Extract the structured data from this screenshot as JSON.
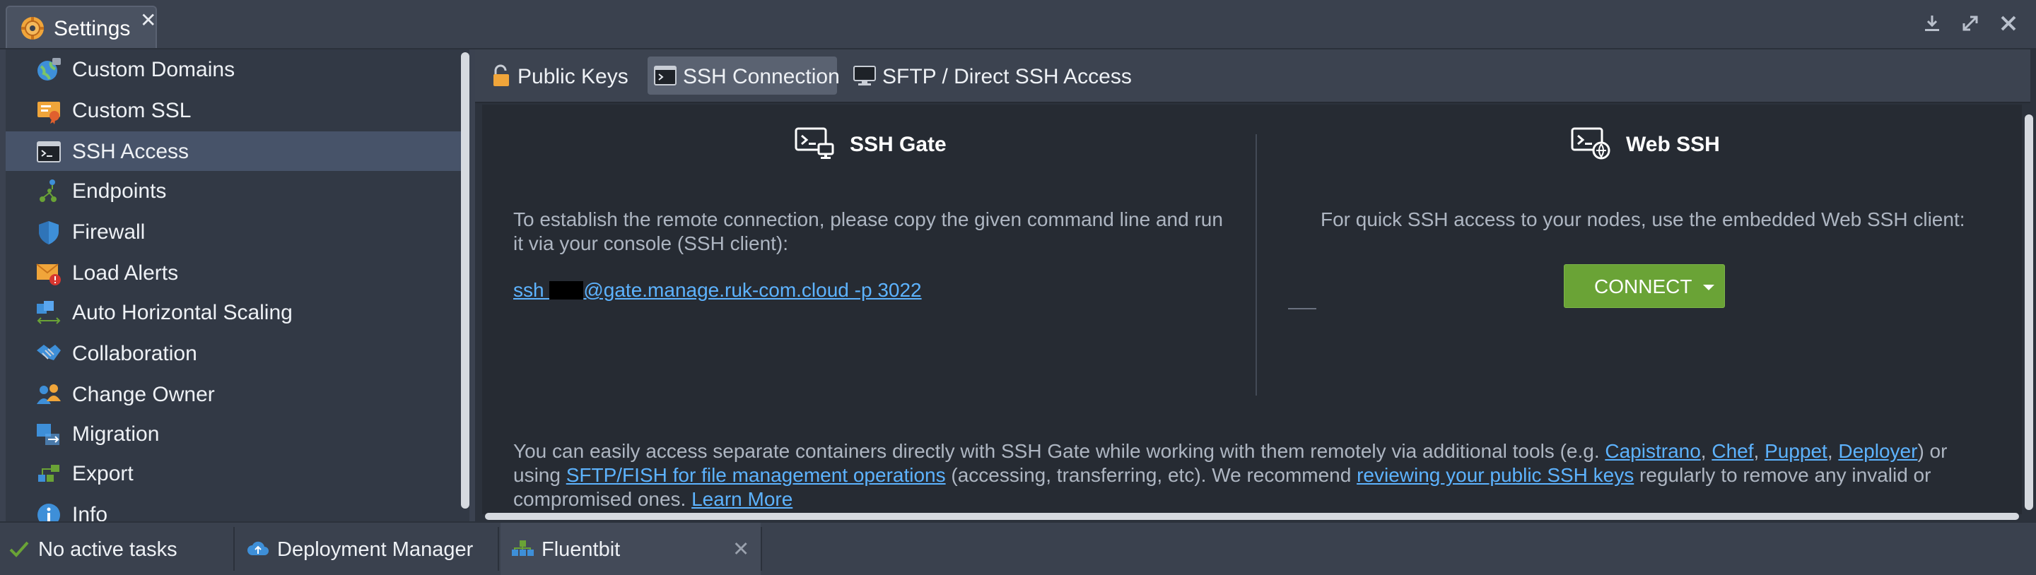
{
  "window": {
    "tab_title": "Settings",
    "close_glyph": "✕",
    "controls": [
      "download-icon",
      "expand-icon",
      "close-icon"
    ]
  },
  "sidebar": {
    "items": [
      {
        "label": "Custom Domains",
        "icon": "globe-icon"
      },
      {
        "label": "Custom SSL",
        "icon": "certificate-icon"
      },
      {
        "label": "SSH Access",
        "icon": "terminal-icon",
        "active": true
      },
      {
        "label": "Endpoints",
        "icon": "endpoints-icon"
      },
      {
        "label": "Firewall",
        "icon": "shield-icon"
      },
      {
        "label": "Load Alerts",
        "icon": "alert-envelope-icon"
      },
      {
        "label": "Auto Horizontal Scaling",
        "icon": "scaling-icon"
      },
      {
        "label": "Collaboration",
        "icon": "handshake-icon"
      },
      {
        "label": "Change Owner",
        "icon": "users-icon"
      },
      {
        "label": "Migration",
        "icon": "migration-icon"
      },
      {
        "label": "Export",
        "icon": "export-icon"
      },
      {
        "label": "Info",
        "icon": "info-icon"
      }
    ]
  },
  "tabs": [
    {
      "label": "Public Keys",
      "icon": "lock-icon"
    },
    {
      "label": "SSH Connection",
      "icon": "terminal-icon",
      "active": true
    },
    {
      "label": "SFTP / Direct SSH Access",
      "icon": "monitor-icon"
    }
  ],
  "ssh_gate": {
    "title": "SSH Gate",
    "description": "To establish the remote connection, please copy the given command line and run it via your console (SSH client):",
    "command_prefix": "ssh ",
    "command_suffix": "@gate.manage.ruk-com.cloud -p 3022"
  },
  "web_ssh": {
    "title": "Web SSH",
    "description": "For quick SSH access to your nodes, use the embedded Web SSH client:",
    "connect_label": "CONNECT",
    "accent": "#6aa336"
  },
  "footer_note": {
    "part1": "You can easily access separate containers directly with SSH Gate while working with them remotely via additional tools (e.g. ",
    "capistrano": "Capistrano",
    "comma1": ", ",
    "chef": "Chef",
    "comma2": ", ",
    "puppet": "Puppet",
    "comma3": ", ",
    "deployer": "Deployer",
    "part2": ") or using ",
    "sftp_fish": "SFTP/FISH for file management operations",
    "part3": " (accessing, transferring, etc). We recommend ",
    "review_keys": "reviewing your public SSH keys",
    "part4": " regularly to remove any invalid or compromised ones. ",
    "learn_more": "Learn More"
  },
  "taskbar": {
    "status": "No active tasks",
    "deployment_manager": "Deployment Manager",
    "env_tab": "Fluentbit",
    "close_glyph": "✕"
  },
  "colors": {
    "link": "#5db3ff",
    "active_row": "#475369",
    "panel_bg": "#262b33"
  }
}
